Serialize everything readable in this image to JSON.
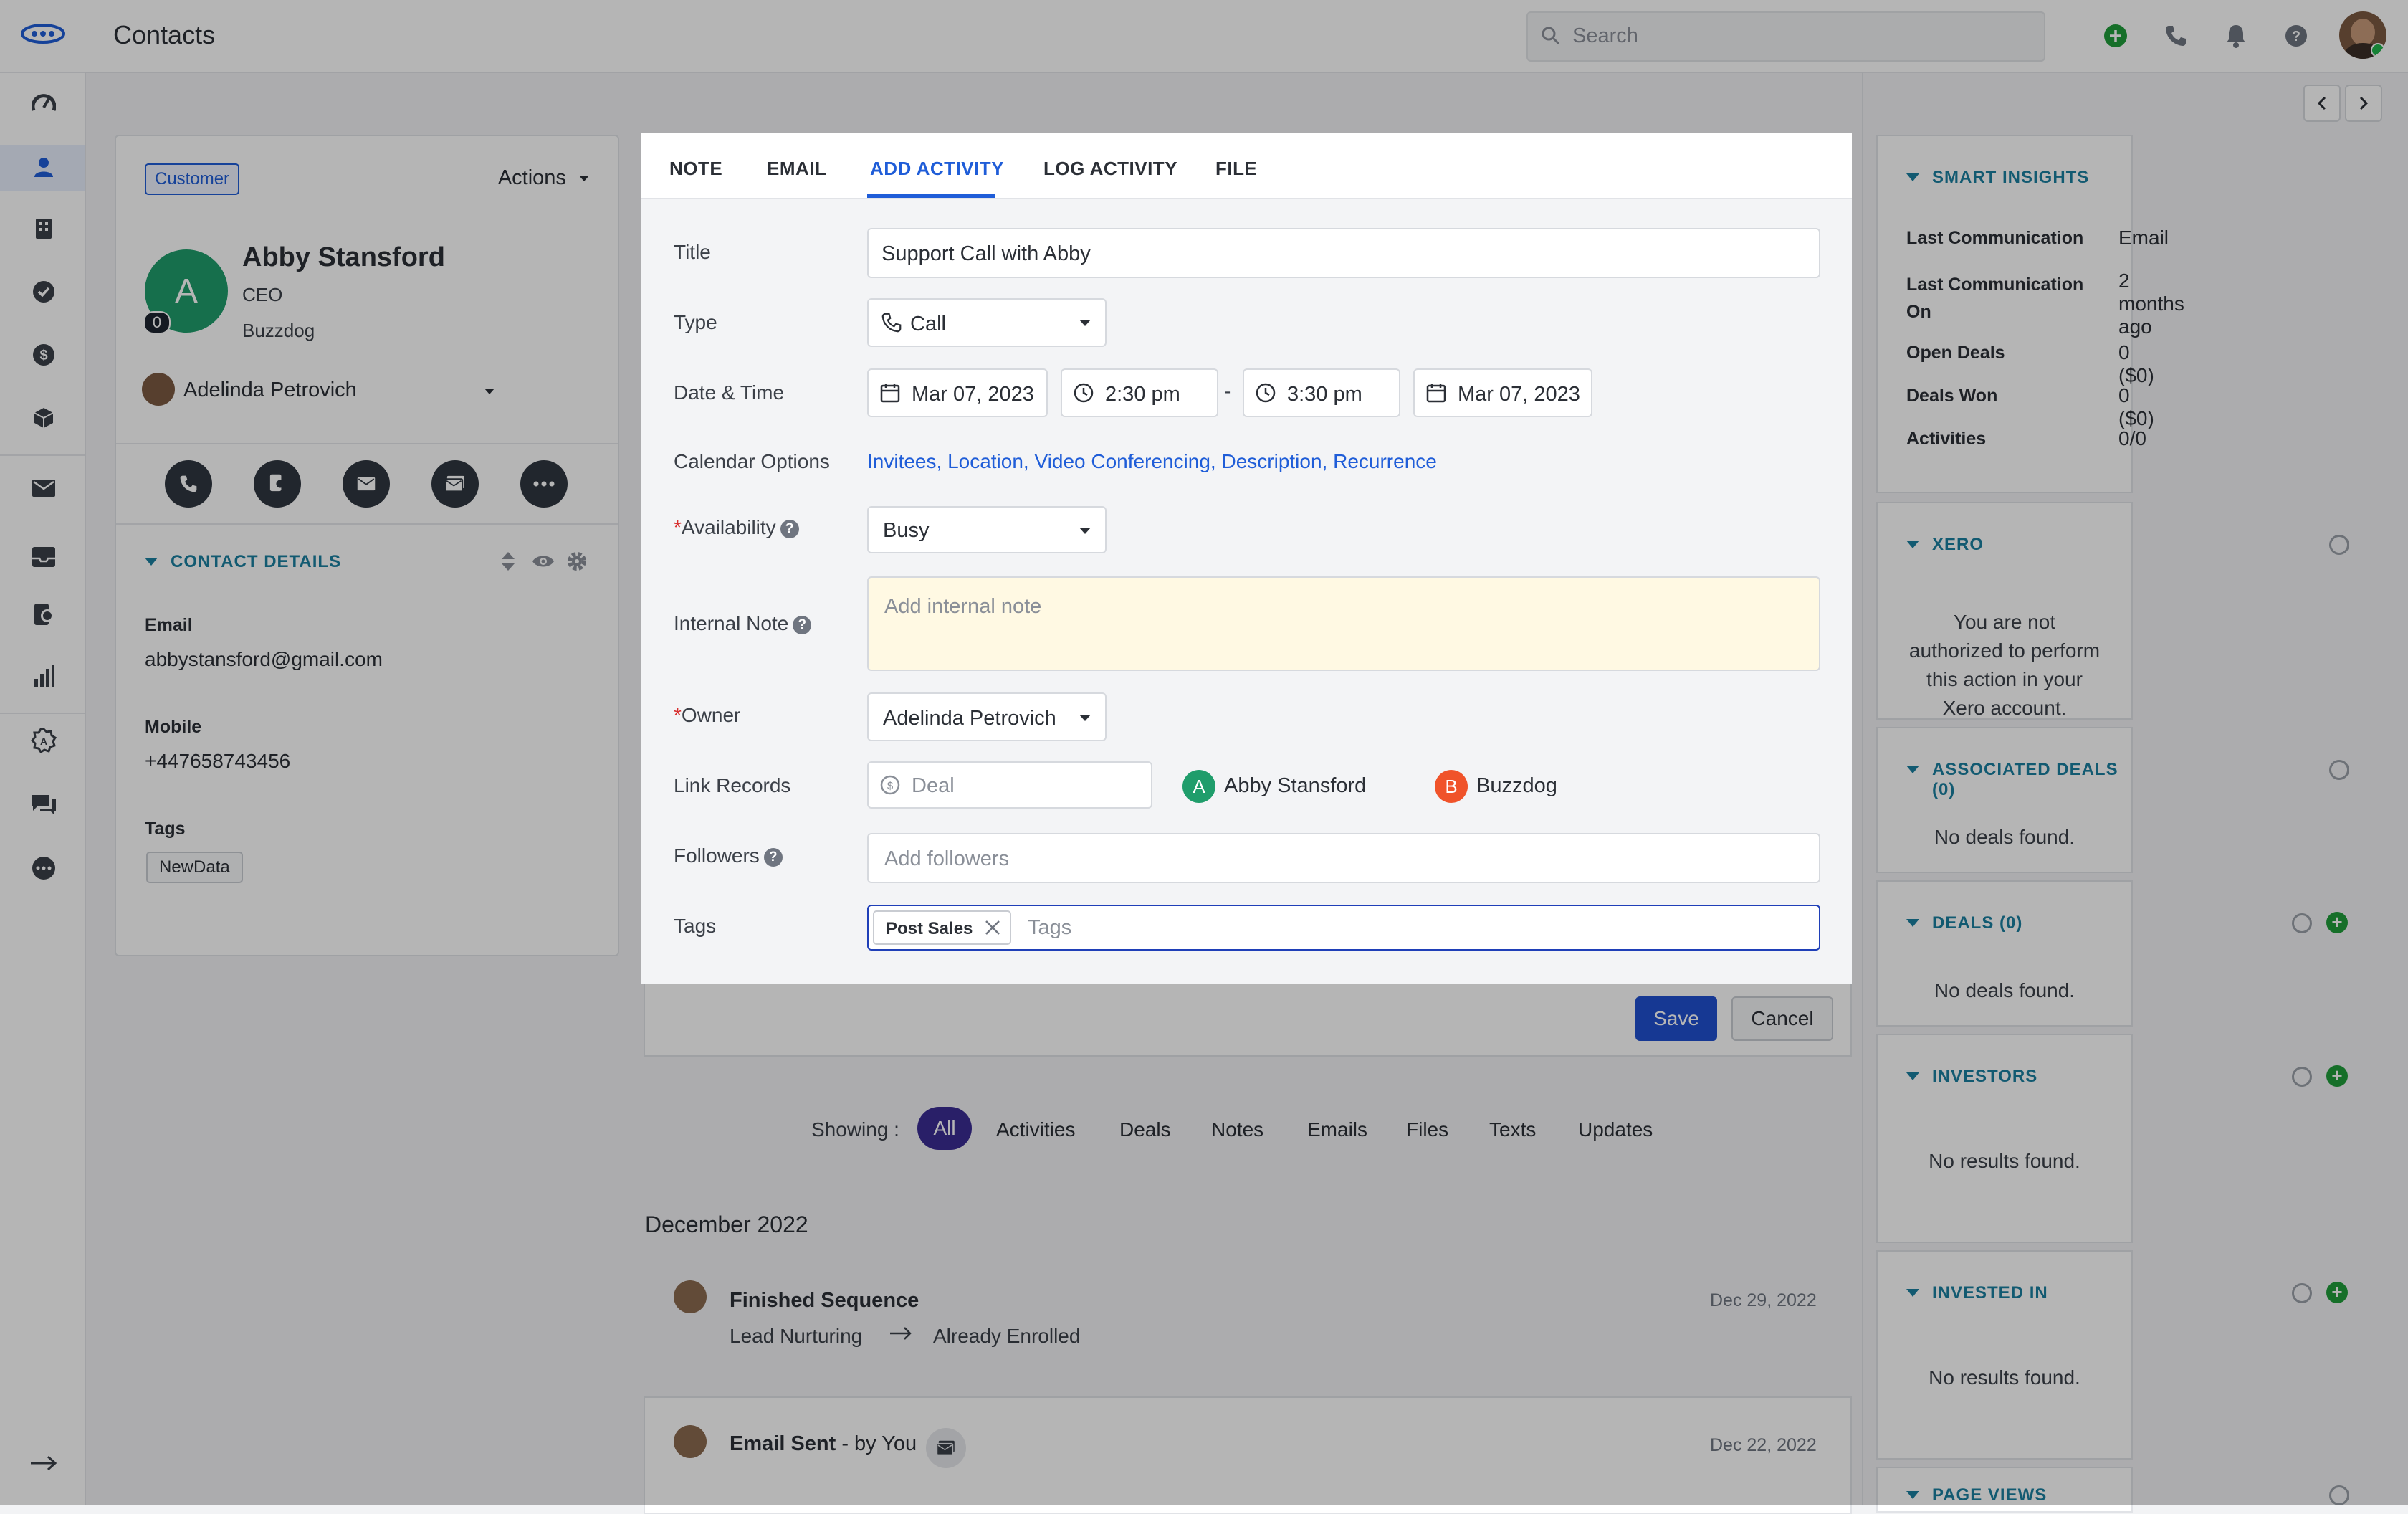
{
  "app": {
    "title": "Contacts",
    "search_placeholder": "Search"
  },
  "sidebar": {
    "items": [
      "logo-icon",
      "dashboard-icon",
      "contacts-icon",
      "companies-icon",
      "tasks-icon",
      "deals-icon",
      "products-icon",
      "email-icon",
      "inbox-icon",
      "sequences-icon",
      "reports-icon",
      "automation-icon",
      "chat-icon",
      "more-icon",
      "collapse-icon"
    ]
  },
  "contact": {
    "badge": "Customer",
    "actions_label": "Actions",
    "avatar_letter": "A",
    "avatar_count": "0",
    "name": "Abby Stansford",
    "title": "CEO",
    "company": "Buzzdog",
    "owner": "Adelinda Petrovich",
    "details_title": "CONTACT DETAILS",
    "email_label": "Email",
    "email": "abbystansford@gmail.com",
    "mobile_label": "Mobile",
    "mobile": "+447658743456",
    "tags_label": "Tags",
    "tag": "NewData"
  },
  "composer": {
    "tabs": [
      "NOTE",
      "EMAIL",
      "ADD ACTIVITY",
      "LOG ACTIVITY",
      "FILE"
    ],
    "active_tab": "ADD ACTIVITY",
    "title_label": "Title",
    "title_value": "Support Call with Abby",
    "type_label": "Type",
    "type_value": "Call",
    "datetime_label": "Date & Time",
    "start_date": "Mar 07, 2023",
    "start_time": "2:30 pm",
    "dash": "-",
    "end_time": "3:30 pm",
    "end_date": "Mar 07, 2023",
    "calendar_label": "Calendar Options",
    "calendar_links": [
      "Invitees,",
      "Location,",
      "Video Conferencing,",
      "Description,",
      "Recurrence"
    ],
    "availability_label": "Availability",
    "availability_value": "Busy",
    "note_label": "Internal Note",
    "note_placeholder": "Add internal note",
    "owner_label": "Owner",
    "owner_value": "Adelinda Petrovich",
    "link_label": "Link Records",
    "deal_placeholder": "Deal",
    "linked_contact_letter": "A",
    "linked_contact": "Abby Stansford",
    "linked_company_letter": "B",
    "linked_company": "Buzzdog",
    "followers_label": "Followers",
    "followers_placeholder": "Add followers",
    "tags_label": "Tags",
    "tag_chip": "Post Sales",
    "tags_placeholder": "Tags",
    "save": "Save",
    "cancel": "Cancel"
  },
  "timeline": {
    "showing_label": "Showing :",
    "filters": [
      "All",
      "Activities",
      "Deals",
      "Notes",
      "Emails",
      "Files",
      "Texts",
      "Updates"
    ],
    "month": "December 2022",
    "events": [
      {
        "title": "Finished Sequence",
        "from": "Lead Nurturing",
        "to": "Already Enrolled",
        "date": "Dec 29, 2022"
      },
      {
        "title": "Email Sent",
        "suffix": "- by You",
        "date": "Dec 22, 2022"
      }
    ]
  },
  "insights": {
    "title": "SMART INSIGHTS",
    "rows": [
      {
        "label": "Last Communication",
        "value": "Email"
      },
      {
        "label": "Last Communication On",
        "value": "2 months ago"
      },
      {
        "label": "Open Deals",
        "value": "0 ($0)"
      },
      {
        "label": "Deals Won",
        "value": "0 ($0)"
      },
      {
        "label": "Activities",
        "value": "0/0"
      }
    ]
  },
  "xero": {
    "title": "XERO",
    "message": "You are not authorized to perform this action in your Xero account."
  },
  "associated_deals": {
    "title": "ASSOCIATED DEALS (0)",
    "empty": "No deals found."
  },
  "deals": {
    "title": "DEALS (0)",
    "empty": "No deals found."
  },
  "investors": {
    "title": "INVESTORS",
    "empty": "No results found."
  },
  "invested_in": {
    "title": "INVESTED IN",
    "empty": "No results found."
  },
  "page_views": {
    "title": "PAGE VIEWS"
  },
  "colors": {
    "accent": "#1f5dd8",
    "teal": "#1a7fa0",
    "green": "#1f9d6b",
    "pill": "#3a2c93"
  }
}
